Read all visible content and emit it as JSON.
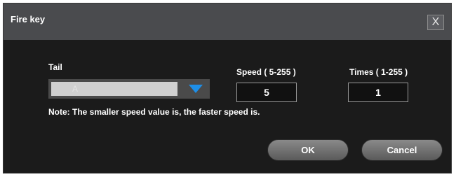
{
  "dialog": {
    "title": "Fire key",
    "close_label": "X"
  },
  "tail": {
    "label": "Tail",
    "selected_value": "A"
  },
  "speed": {
    "label": "Speed ( 5-255 )",
    "value": "5"
  },
  "times": {
    "label": "Times ( 1-255 )",
    "value": "1"
  },
  "note": "Note: The smaller speed value is, the faster speed is.",
  "buttons": {
    "ok_label": "OK",
    "cancel_label": "Cancel"
  },
  "colors": {
    "dialog_bg": "#1b1b1b",
    "titlebar_bg": "#4a4b4e",
    "accent_arrow": "#1e8fe8"
  }
}
